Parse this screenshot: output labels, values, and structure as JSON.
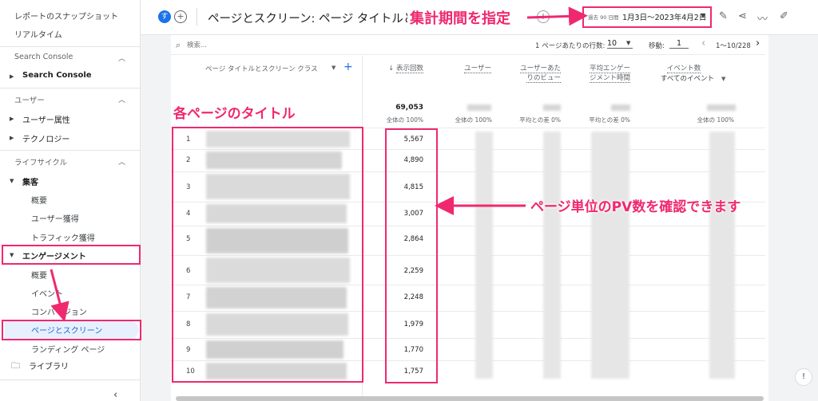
{
  "sidebar": {
    "top_links": [
      "レポートのスナップショット",
      "リアルタイム"
    ],
    "sections": {
      "search_console": {
        "heading": "Search Console",
        "item": "Search Console"
      },
      "user": {
        "heading": "ユーザー",
        "items": [
          "ユーザー属性",
          "テクノロジー"
        ]
      },
      "lifecycle": {
        "heading": "ライフサイクル",
        "acquisition": {
          "label": "集客",
          "items": [
            "概要",
            "ユーザー獲得",
            "トラフィック獲得"
          ]
        },
        "engagement": {
          "label": "エンゲージメント",
          "items": [
            "概要",
            "イベント",
            "コンバージョン",
            "ページとスクリーン",
            "ランディング ページ"
          ]
        }
      }
    },
    "library": "ライブラリ",
    "collapse_icon": "chevron-left-icon"
  },
  "header": {
    "avatar_letter": "す",
    "title": "ページとスクリーン: ページ タイトルとスクリーン クラス",
    "date_range_label": "過去 90 日間",
    "date_range": "1月3日〜2023年4月2日"
  },
  "toolbar": {
    "search_placeholder": "検索...",
    "rows_per_page_label": "1 ページあたりの行数:",
    "rows_per_page": "10",
    "move_label": "移動:",
    "move_value": "1",
    "pager_range": "1〜10/228"
  },
  "table": {
    "dimension_header": "ページ タイトルとスクリーン クラス",
    "columns": [
      {
        "label": "表示回数",
        "sort": "↓"
      },
      {
        "label": "ユーザー"
      },
      {
        "label": "ユーザーあたりのビュー"
      },
      {
        "label": "平均エンゲージメント時間"
      },
      {
        "label": "イベント数",
        "sub": "すべてのイベント"
      }
    ],
    "totals": {
      "views": "69,053",
      "views_sub": "全体の 100%",
      "users_sub": "全体の 100%",
      "vpu_sub": "平均との差 0%",
      "avg_sub": "平均との差 0%",
      "events_sub": "全体の 100%"
    },
    "rows": [
      {
        "idx": "1",
        "views": "5,567"
      },
      {
        "idx": "2",
        "views": "4,890"
      },
      {
        "idx": "3",
        "views": "4,815"
      },
      {
        "idx": "4",
        "views": "3,007"
      },
      {
        "idx": "5",
        "views": "2,864"
      },
      {
        "idx": "6",
        "views": "2,259"
      },
      {
        "idx": "7",
        "views": "2,248"
      },
      {
        "idx": "8",
        "views": "1,979"
      },
      {
        "idx": "9",
        "views": "1,770"
      },
      {
        "idx": "10",
        "views": "1,757"
      }
    ]
  },
  "annotations": {
    "date_note": "集計期間を指定",
    "title_note": "各ページのタイトル",
    "pv_note": "ページ単位のPV数を確認できます"
  },
  "colors": {
    "accent": "#f0286f",
    "primary": "#1a73e8"
  }
}
